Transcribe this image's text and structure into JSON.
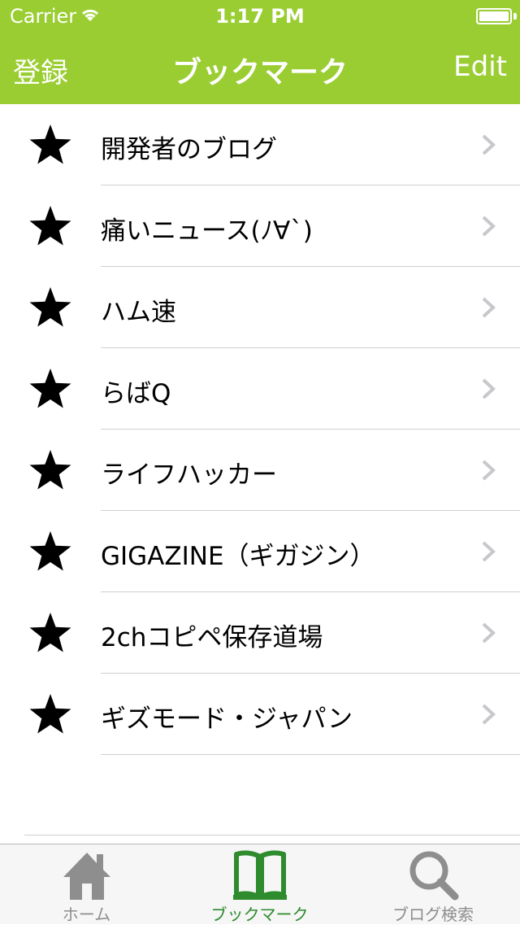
{
  "status_bar": {
    "carrier": "Carrier",
    "time": "1:17 PM"
  },
  "nav": {
    "left_button": "登録",
    "title": "ブックマーク",
    "right_button": "Edit"
  },
  "bookmarks": [
    {
      "label": "開発者のブログ"
    },
    {
      "label": "痛いニュース(ﾉ∀`)"
    },
    {
      "label": "ハム速"
    },
    {
      "label": "らばQ"
    },
    {
      "label": "ライフハッカー"
    },
    {
      "label": "GIGAZINE（ギガジン）"
    },
    {
      "label": "2chコピペ保存道場"
    },
    {
      "label": "ギズモード・ジャパン"
    }
  ],
  "tabs": [
    {
      "label": "ホーム",
      "icon": "home-icon",
      "active": false
    },
    {
      "label": "ブックマーク",
      "icon": "book-icon",
      "active": true
    },
    {
      "label": "ブログ検索",
      "icon": "search-icon",
      "active": false
    }
  ],
  "colors": {
    "accent": "#9acd32",
    "tab_active": "#2e8b2e",
    "tab_inactive": "#8e8e8e"
  }
}
